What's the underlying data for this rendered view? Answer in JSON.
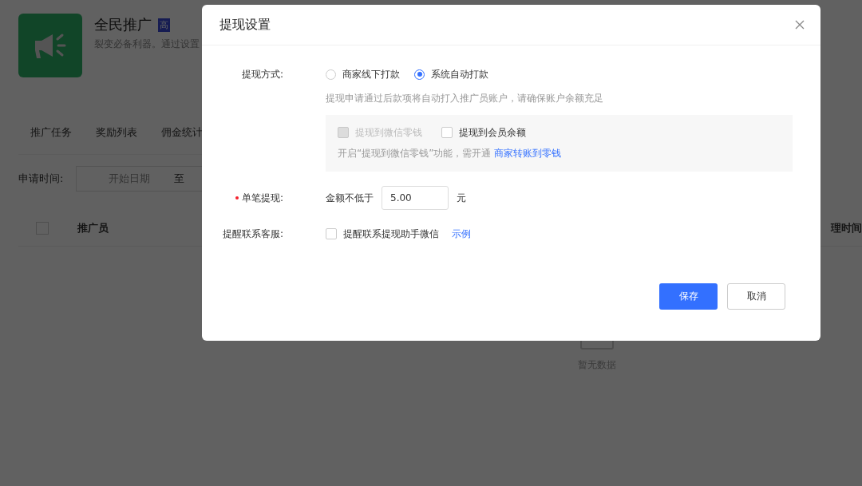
{
  "page": {
    "header": {
      "title": "全民推广",
      "badge": "高",
      "subtitle": "裂变必备利器。通过设置"
    },
    "tabs": [
      {
        "label": "推广任务"
      },
      {
        "label": "奖励列表"
      },
      {
        "label": "佣金统计"
      }
    ],
    "filter": {
      "label": "申请时间:",
      "start_placeholder": "开始日期",
      "separator": "至"
    },
    "table": {
      "select_all_checked": false,
      "columns": [
        "推广员",
        "理时间"
      ],
      "empty_text": "暂无数据"
    }
  },
  "dialog": {
    "title": "提现设置",
    "method": {
      "label": "提现方式:",
      "options": [
        {
          "label": "商家线下打款",
          "selected": false
        },
        {
          "label": "系统自动打款",
          "selected": true
        }
      ],
      "hint": "提现申请通过后款项将自动打入推广员账户，请确保账户余额充足"
    },
    "targets": {
      "options": [
        {
          "label": "提现到微信零钱",
          "checked": false,
          "disabled": true
        },
        {
          "label": "提现到会员余额",
          "checked": false,
          "disabled": false
        }
      ],
      "note": "开启“提现到微信零钱”功能，需开通",
      "link": "商家转账到零钱"
    },
    "single": {
      "label": "单笔提现:",
      "required": true,
      "prefix": "金额不低于",
      "value": "5.00",
      "unit": "元"
    },
    "remind": {
      "label": "提醒联系客服:",
      "option": {
        "label": "提醒联系提现助手微信",
        "checked": false
      },
      "link": "示例"
    },
    "buttons": [
      {
        "label": "保存",
        "kind": "primary"
      },
      {
        "label": "取消",
        "kind": "default"
      }
    ]
  }
}
